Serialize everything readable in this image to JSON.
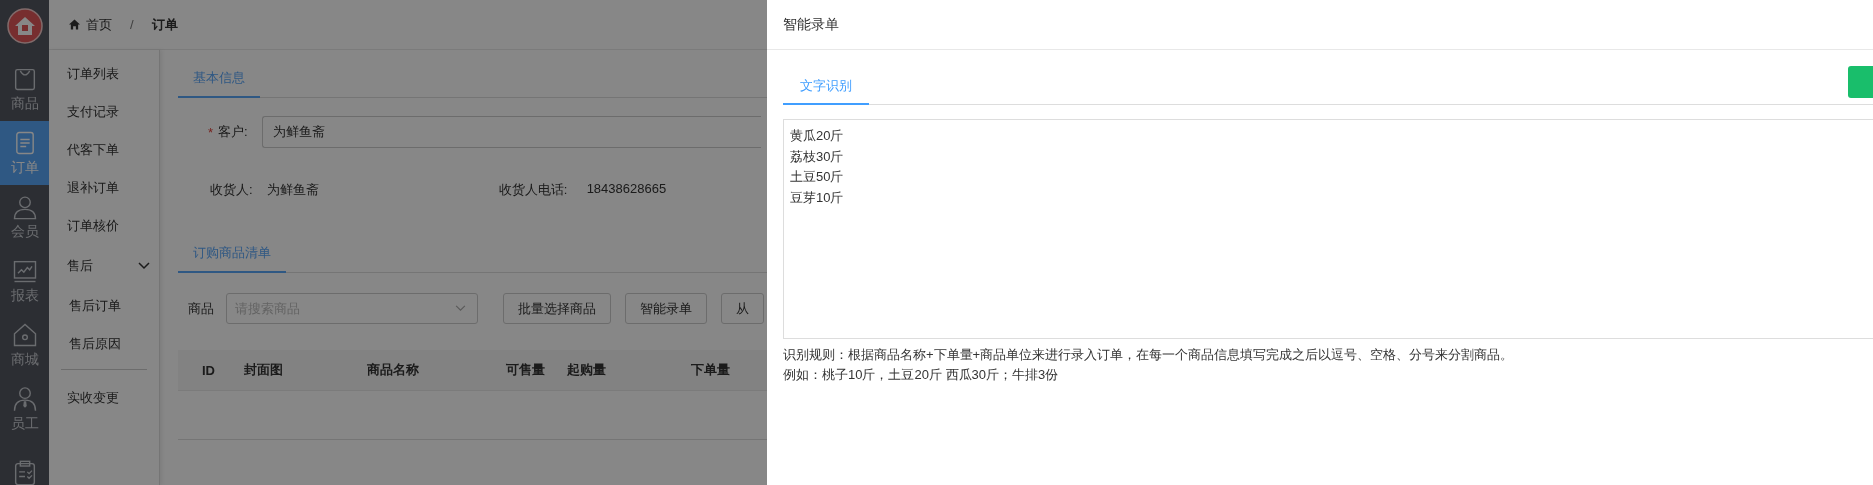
{
  "sidebar": {
    "items": [
      {
        "label": "商品",
        "selected": false
      },
      {
        "label": "订单",
        "selected": true
      },
      {
        "label": "会员",
        "selected": false
      },
      {
        "label": "报表",
        "selected": false
      },
      {
        "label": "商城",
        "selected": false
      },
      {
        "label": "员工",
        "selected": false
      },
      {
        "selected": false
      }
    ]
  },
  "submenu": {
    "items": [
      {
        "kind": "link",
        "label": "订单列表"
      },
      {
        "kind": "link",
        "label": "支付记录"
      },
      {
        "kind": "link",
        "label": "代客下单"
      },
      {
        "kind": "link",
        "label": "退补订单"
      },
      {
        "kind": "link",
        "label": "订单核价"
      },
      {
        "kind": "group",
        "label": "售后",
        "expanded": true,
        "children": [
          {
            "label": "售后订单"
          },
          {
            "label": "售后原因"
          }
        ]
      },
      {
        "kind": "link",
        "label": "实收变更"
      }
    ]
  },
  "breadcrumb": {
    "items": [
      "首页",
      "订单"
    ],
    "separator": "/"
  },
  "basic_info": {
    "tab": "基本信息",
    "customer": {
      "required_mark": "*",
      "label": "客户:",
      "value": "为鲜鱼斋"
    },
    "consignee": {
      "label": "收货人:",
      "value": "为鲜鱼斋"
    },
    "phone": {
      "label": "收货人电话:",
      "value": "18438628665"
    }
  },
  "goods": {
    "tab": "订购商品清单",
    "search": {
      "label": "商品",
      "placeholder": "请搜索商品"
    },
    "buttons": [
      "批量选择商品",
      "智能录单",
      "从"
    ],
    "table": {
      "columns": [
        "ID",
        "封面图",
        "商品名称",
        "可售量",
        "起购量",
        "下单量"
      ]
    }
  },
  "drawer": {
    "title": "智能录单",
    "tabs": [
      {
        "label": "文字识别",
        "selected": true
      }
    ],
    "text": {
      "lines": [
        "黄瓜20斤",
        "荔枝30斤",
        "土豆50斤",
        "豆芽10斤"
      ]
    },
    "rules": "识别规则：根据商品名称+下单量+商品单位来进行录入订单，在每一个商品信息填写完成之后以逗号、空格、分号来分割商品。",
    "example": "例如：桃子10斤，土豆20斤 西瓜30斤；牛排3份"
  }
}
